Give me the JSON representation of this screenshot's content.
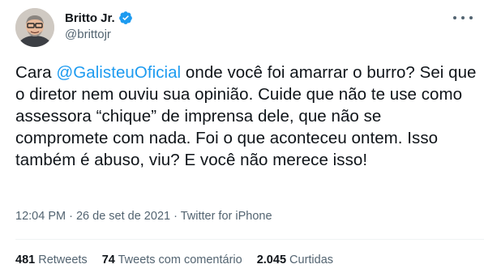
{
  "author": {
    "display_name": "Britto Jr.",
    "handle": "@brittojr",
    "verified": true,
    "avatar_icon": "person-avatar"
  },
  "tweet": {
    "text_before_mention": "Cara ",
    "mention": "@GalisteuOficial",
    "text_after_mention": " onde você foi amarrar o burro? Sei que o diretor nem ouviu sua opinião. Cuide que não te use como assessora “chique” de imprensa dele, que não se compromete com nada. Foi o que aconteceu ontem. Isso também é abuso, viu? E você não merece isso!"
  },
  "meta": {
    "time": "12:04 PM",
    "separator1": " · ",
    "date": "26 de set de 2021",
    "separator2": " · ",
    "source": "Twitter for iPhone"
  },
  "stats": {
    "retweets_count": "481",
    "retweets_label": " Retweets",
    "quotes_count": "74",
    "quotes_label": " Tweets com comentário",
    "likes_count": "2.045",
    "likes_label": " Curtidas"
  },
  "colors": {
    "accent": "#1d9bf0",
    "secondary_text": "#536471",
    "primary_text": "#0f1419",
    "divider": "#eff3f4"
  }
}
